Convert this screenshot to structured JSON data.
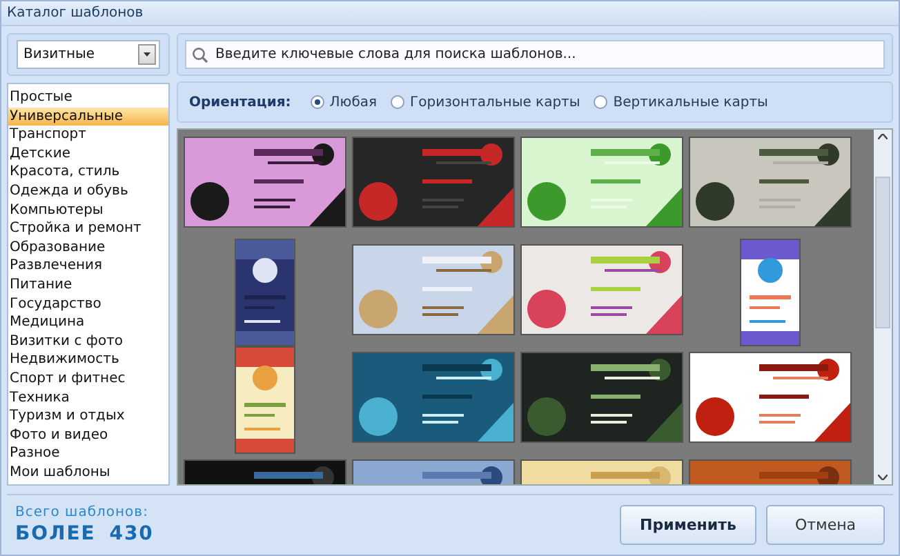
{
  "window": {
    "title": "Каталог шаблонов"
  },
  "category_dropdown": {
    "value": "Визитные"
  },
  "categories": [
    {
      "label": "Простые",
      "selected": false
    },
    {
      "label": "Универсальные",
      "selected": true
    },
    {
      "label": "Транспорт",
      "selected": false
    },
    {
      "label": "Детские",
      "selected": false
    },
    {
      "label": "Красота, стиль",
      "selected": false
    },
    {
      "label": "Одежда и обувь",
      "selected": false
    },
    {
      "label": "Компьютеры",
      "selected": false
    },
    {
      "label": "Стройка и ремонт",
      "selected": false
    },
    {
      "label": "Образование",
      "selected": false
    },
    {
      "label": "Развлечения",
      "selected": false
    },
    {
      "label": "Питание",
      "selected": false
    },
    {
      "label": "Государство",
      "selected": false
    },
    {
      "label": "Медицина",
      "selected": false
    },
    {
      "label": "Визитки с фото",
      "selected": false
    },
    {
      "label": "Недвижимость",
      "selected": false
    },
    {
      "label": "Спорт и фитнес",
      "selected": false
    },
    {
      "label": "Техника",
      "selected": false
    },
    {
      "label": "Туризм и отдых",
      "selected": false
    },
    {
      "label": "Фото и видео",
      "selected": false
    },
    {
      "label": "Разное",
      "selected": false
    },
    {
      "label": "Мои шаблоны",
      "selected": false
    }
  ],
  "search": {
    "placeholder": "Введите ключевые слова для поиска шаблонов..."
  },
  "orientation": {
    "label": "Ориентация:",
    "options": [
      {
        "label": "Любая",
        "selected": true
      },
      {
        "label": "Горизонтальные карты",
        "selected": false
      },
      {
        "label": "Вертикальные карты",
        "selected": false
      }
    ]
  },
  "templates": [
    {
      "kind": "horizontal"
    },
    {
      "kind": "horizontal"
    },
    {
      "kind": "horizontal"
    },
    {
      "kind": "horizontal"
    },
    {
      "kind": "vertical"
    },
    {
      "kind": "horizontal"
    },
    {
      "kind": "horizontal"
    },
    {
      "kind": "vertical"
    },
    {
      "kind": "vertical"
    },
    {
      "kind": "horizontal"
    },
    {
      "kind": "horizontal"
    },
    {
      "kind": "horizontal"
    },
    {
      "kind": "horizontal"
    },
    {
      "kind": "horizontal"
    },
    {
      "kind": "horizontal"
    },
    {
      "kind": "horizontal"
    }
  ],
  "footer": {
    "total_label": "Всего шаблонов:",
    "total_value": "БОЛЕЕ 430"
  },
  "buttons": [
    {
      "label": "Применить",
      "default": true
    },
    {
      "label": "Отмена",
      "default": false
    }
  ]
}
